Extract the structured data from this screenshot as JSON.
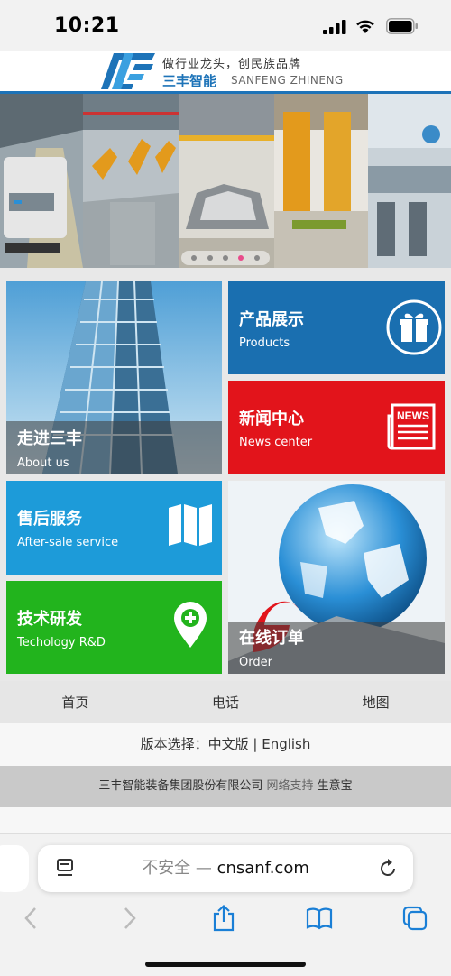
{
  "status_bar": {
    "time": "10:21"
  },
  "header": {
    "slogan": "做行业龙头，创民族品牌",
    "brand_cn": "三丰智能",
    "brand_en": "SANFENG ZHINENG"
  },
  "banner": {
    "slide_count": 5,
    "active_slide": 4
  },
  "tiles": {
    "about": {
      "cn": "走进三丰",
      "en": "About us"
    },
    "products": {
      "cn": "产品展示",
      "en": "Products"
    },
    "news": {
      "cn": "新闻中心",
      "en": "News center",
      "badge": "NEWS"
    },
    "aftersale": {
      "cn": "售后服务",
      "en": "After-sale service"
    },
    "rnd": {
      "cn": "技术研发",
      "en": "Techology R&D"
    },
    "order": {
      "cn": "在线订单",
      "en": "Order"
    }
  },
  "footer_nav": {
    "home": "首页",
    "phone": "电话",
    "map": "地图"
  },
  "version": {
    "label": "版本选择：",
    "cn": "中文版",
    "sep": " | ",
    "en": "English"
  },
  "copyright": {
    "company": "三丰智能装备集团股份有限公司",
    "support_label": "网络支持",
    "support_name": "生意宝"
  },
  "browser": {
    "insecure": "不安全",
    "dash": " — ",
    "domain": "cnsanf.com"
  },
  "colors": {
    "blue_dark": "#1a6fb0",
    "blue_light": "#1d9bd9",
    "red": "#e2141b",
    "green": "#22b41d",
    "brand_blue": "#1d73b8"
  }
}
